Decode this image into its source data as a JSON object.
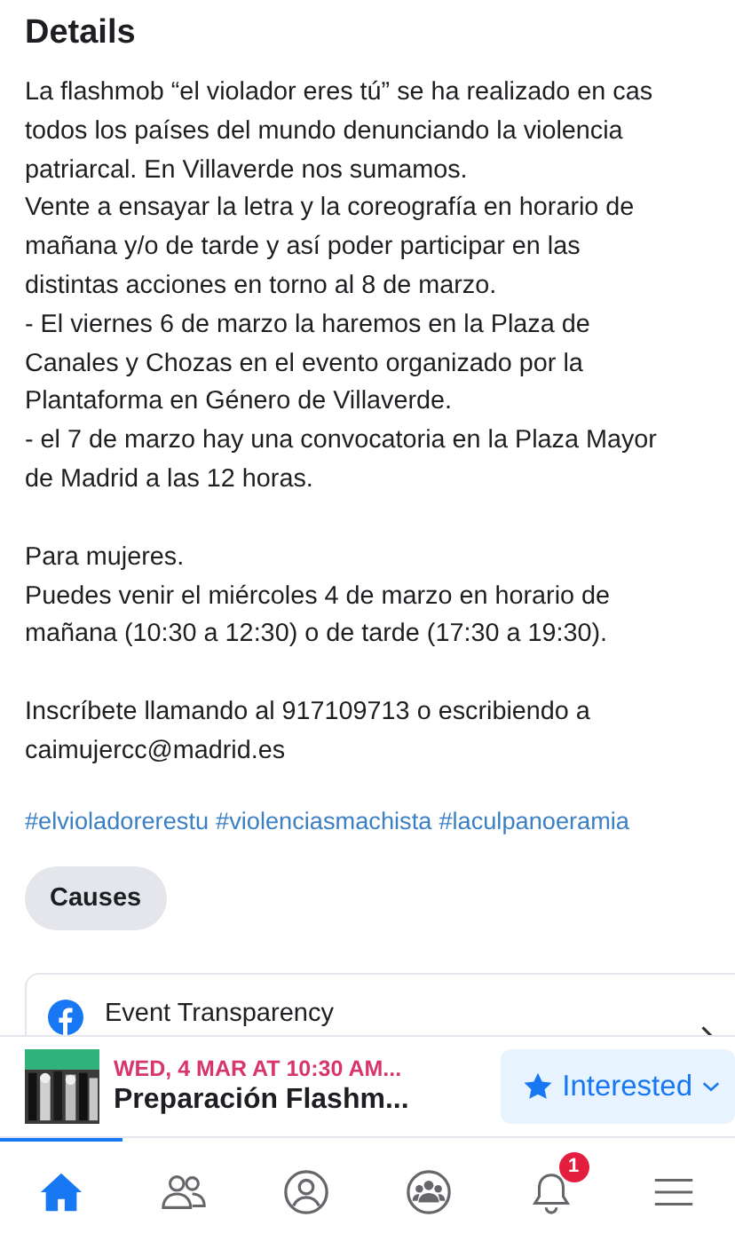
{
  "heading": "Details",
  "paragraphs": [
    {
      "lines": [
        "La flashmob “el violador eres tú” se ha realizado en cas",
        "todos los países del mundo denunciando la violencia",
        "patriarcal. En Villaverde nos sumamos.",
        "Vente a ensayar la letra y la coreografía en horario de",
        "mañana y/o de tarde y así poder participar en las",
        "distintas acciones en torno al 8 de marzo.",
        "- El viernes 6 de marzo la haremos en la Plaza de",
        "Canales y Chozas en el evento organizado por la",
        "Plantaforma en Género de Villaverde.",
        "- el 7 de marzo hay una convocatoria en la Plaza Mayor",
        "de Madrid a las 12 horas."
      ]
    },
    {
      "lines": [
        "Para mujeres.",
        "Puedes venir el miércoles 4 de marzo  en horario de",
        "mañana (10:30 a 12:30) o de tarde (17:30 a 19:30)."
      ]
    },
    {
      "lines": [
        "Inscríbete llamando al 917109713 o escribiendo a",
        "caimujercc@madrid.es"
      ]
    }
  ],
  "hashtags": [
    "#elvioladorerestu",
    "#violenciasmachista",
    "#laculpanoeramia"
  ],
  "category_button": "Causes",
  "transparency": {
    "title": "Event Transparency"
  },
  "event_bar": {
    "date": "WED, 4 MAR AT 10:30 AM...",
    "title": "Preparación Flashm...",
    "button": "Interested"
  },
  "nav": [
    {
      "kind": "home",
      "selected": true
    },
    {
      "kind": "friends",
      "selected": false
    },
    {
      "kind": "profile",
      "selected": false
    },
    {
      "kind": "groups",
      "selected": false
    },
    {
      "kind": "notifications",
      "selected": false,
      "badge": "1"
    },
    {
      "kind": "menu",
      "selected": false
    }
  ]
}
